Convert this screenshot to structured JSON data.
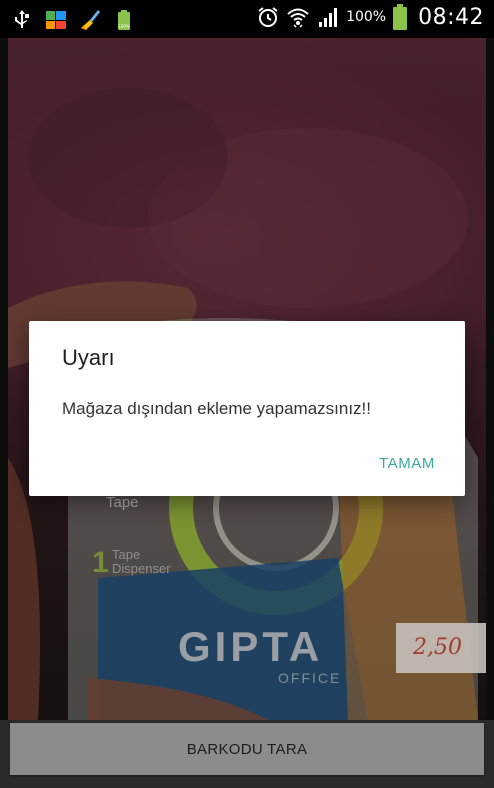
{
  "status_bar": {
    "left_icons": [
      "usb-icon",
      "photo-gallery-icon",
      "cleaner-broom-icon",
      "android-battery-icon"
    ],
    "right_icons": [
      "alarm-icon",
      "wifi-icon",
      "signal-icon",
      "battery-icon"
    ],
    "battery_percent": "100%",
    "time": "08:42",
    "colors": {
      "background": "#000000",
      "text": "#ffffff",
      "battery": "#8bc34a"
    }
  },
  "camera": {
    "product_labels": {
      "tape": "Tape",
      "dispenser_count": "1",
      "dispenser": "Tape\nDispenser",
      "brand": "GIPTA",
      "brand_sub": "OFFICE",
      "price_tag": "2,50"
    }
  },
  "dialog": {
    "title": "Uyarı",
    "message": "Mağaza dışından ekleme yapamazsınız!!",
    "ok_button": "TAMAM",
    "accent_color": "#3aa99f"
  },
  "bottom": {
    "scan_button": "BARKODU TARA"
  }
}
